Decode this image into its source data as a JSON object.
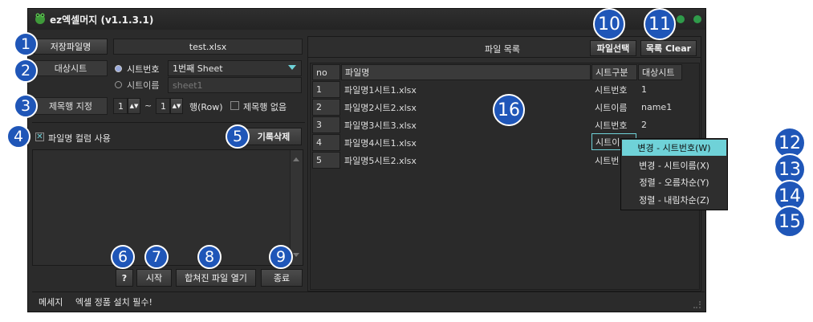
{
  "window": {
    "title": "ez엑셀머지 (v1.1.3.1)",
    "icon_name": "frog-app-icon",
    "accent": "#6fd2d8",
    "badge_color": "#1f56b8"
  },
  "left": {
    "save_file_label": "저장파일명",
    "save_file_value": "test.xlsx",
    "target_sheet_label": "대상시트",
    "radio_sheet_number": "시트번호",
    "sheet_number_value": "1번째 Sheet",
    "radio_sheet_name": "시트이름",
    "sheet_name_placeholder": "sheet1",
    "title_row_label": "제목행 지정",
    "title_row_from": "1",
    "title_row_tilde": "~",
    "title_row_to": "1",
    "title_row_unit": "행(Row)",
    "no_title_row_label": "제목행 없음",
    "use_filename_column_label": "파일명 컬럼 사용",
    "delete_log_button": "기록삭제",
    "help_button": "?",
    "start_button": "시작",
    "open_merged_button": "합쳐진 파일 열기",
    "exit_button": "종료"
  },
  "right": {
    "file_list_label": "파일 목록",
    "select_file_button": "파일선택",
    "clear_list_button": "목록 Clear",
    "columns": [
      "no",
      "파일명",
      "시트구분",
      "대상시트"
    ],
    "rows": [
      {
        "no": "1",
        "file": "파일명1시트1.xlsx",
        "kind": "시트번호",
        "target": "1"
      },
      {
        "no": "2",
        "file": "파일명2시트2.xlsx",
        "kind": "시트이름",
        "target": "name1"
      },
      {
        "no": "3",
        "file": "파일명3시트3.xlsx",
        "kind": "시트번호",
        "target": "2"
      },
      {
        "no": "4",
        "file": "파일명4시트1.xlsx",
        "kind": "시트이름",
        "target": ""
      },
      {
        "no": "5",
        "file": "파일명5시트2.xlsx",
        "kind": "시트번",
        "target": ""
      }
    ]
  },
  "context_menu": {
    "items": [
      "변경 - 시트번호(W)",
      "변경 - 시트이름(X)",
      "정렬 - 오름차순(Y)",
      "정렬 - 내림차순(Z)"
    ]
  },
  "status": {
    "label": "메세지",
    "message": "엑셀 정품 설치 필수!"
  },
  "badges": [
    "1",
    "2",
    "3",
    "4",
    "5",
    "6",
    "7",
    "8",
    "9",
    "10",
    "11",
    "12",
    "13",
    "14",
    "15",
    "16"
  ]
}
